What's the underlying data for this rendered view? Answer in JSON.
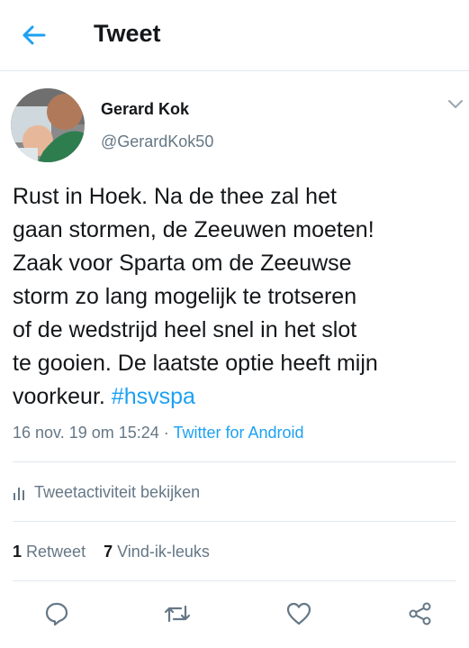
{
  "header": {
    "title": "Tweet",
    "back_icon": "arrow-left-icon"
  },
  "colors": {
    "accent": "#1da1f2",
    "secondary_text": "#657786",
    "divider": "#e1e8ed"
  },
  "tweet": {
    "author_name": "Gerard Kok",
    "handle": "@GerardKok50",
    "text": "Rust in Hoek. Na de thee zal het\ngaan stormen, de Zeeuwen moeten!\nZaak voor Sparta om de Zeeuwse\nstorm zo lang mogelijk te trotseren\nof de wedstrijd heel snel in het slot\nte gooien. De laatste optie heeft mijn\nvoorkeur.",
    "hashtag": "#hsvspa",
    "timestamp": "16 nov. 19 om 15:24",
    "separator": " · ",
    "source": "Twitter for Android"
  },
  "activity": {
    "label": "Tweetactiviteit bekijken"
  },
  "stats": {
    "retweet_count": "1",
    "retweet_label": "Retweet",
    "like_count": "7",
    "like_label": "Vind-ik-leuks"
  }
}
